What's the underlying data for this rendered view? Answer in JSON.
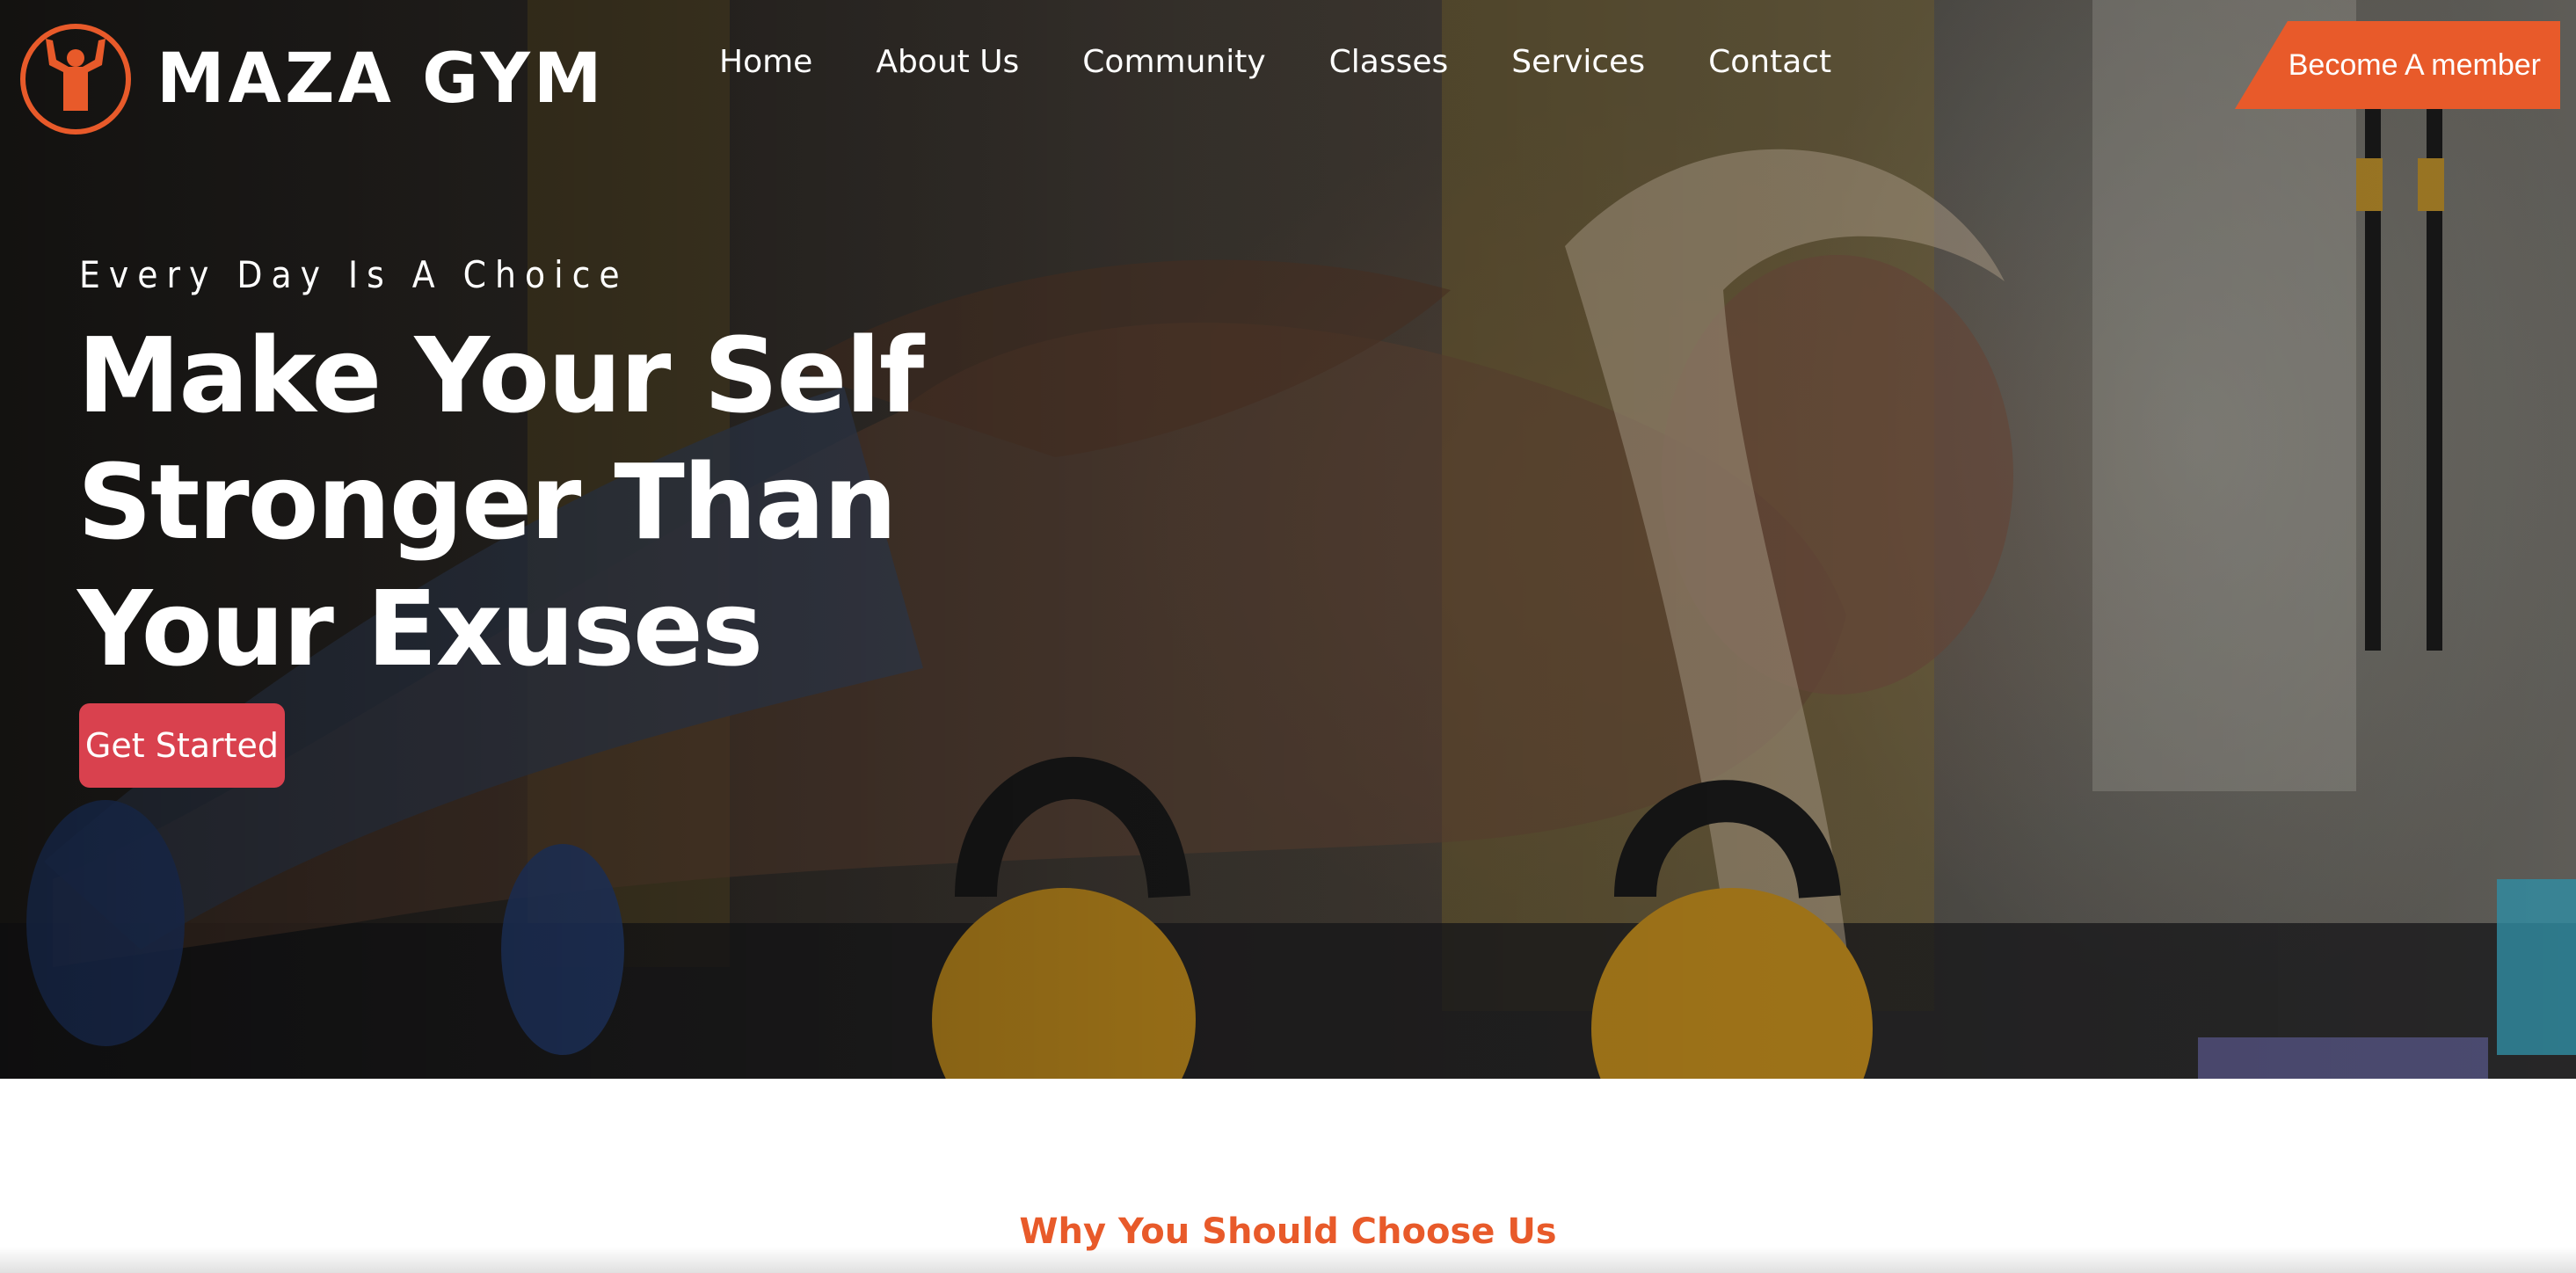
{
  "brand": {
    "name": "MAZA GYM",
    "logo_icon": "flexing-person-icon",
    "accent_color": "#e85a2a"
  },
  "nav": {
    "items": [
      {
        "label": "Home"
      },
      {
        "label": "About Us"
      },
      {
        "label": "Community"
      },
      {
        "label": "Classes"
      },
      {
        "label": "Services"
      },
      {
        "label": "Contact"
      }
    ],
    "cta_label": "Become A member"
  },
  "hero": {
    "eyebrow": "Every Day Is A Choice",
    "title_lines": [
      "Make Your Self",
      "Stronger Than",
      "Your Exuses"
    ],
    "button_label": "Get Started",
    "button_color": "#d9414e"
  },
  "section": {
    "heading": "Why You Should Choose Us"
  }
}
